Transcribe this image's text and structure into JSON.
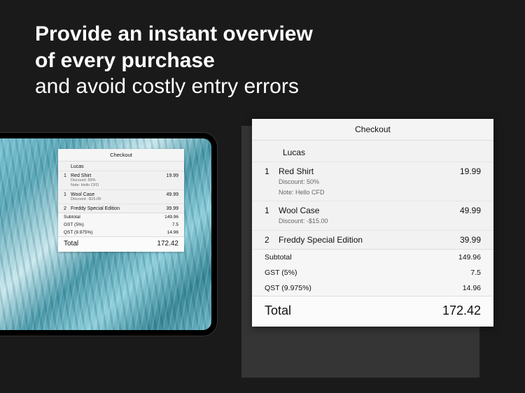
{
  "hero": {
    "line1": "Provide an instant overview",
    "line2": "of every purchase",
    "line3": "and avoid costly entry errors"
  },
  "receipt": {
    "title": "Checkout",
    "customer": "Lucas",
    "items": [
      {
        "qty": "1",
        "name": "Red Shirt",
        "price": "19.99",
        "discount": "Discount: 50%",
        "note": "Note: Hello CFD"
      },
      {
        "qty": "1",
        "name": "Wool Case",
        "price": "49.99",
        "discount": "Discount: -$15.00",
        "note": ""
      },
      {
        "qty": "2",
        "name": "Freddy Special Edition",
        "price": "39.99",
        "discount": "",
        "note": ""
      }
    ],
    "summary": [
      {
        "label": "Subtotal",
        "value": "149.96"
      },
      {
        "label": "GST (5%)",
        "value": "7.5"
      },
      {
        "label": "QST (9.975%)",
        "value": "14.96"
      }
    ],
    "total_label": "Total",
    "total_value": "172.42"
  },
  "small_receipt": {
    "summary": [
      {
        "label": "Subtotal",
        "value": "149.96"
      },
      {
        "label": "GST (5%)",
        "value": "7.5"
      },
      {
        "label": "QST (9.975%)",
        "value": "14.96"
      }
    ],
    "items": [
      {
        "qty": "1",
        "name": "Red Shirt",
        "price": "19.99",
        "discount": "Discount: 50%",
        "note": "Note: Hello CFD"
      },
      {
        "qty": "1",
        "name": "Wool Case",
        "price": "49.99",
        "discount": "Discount: -$15.09",
        "note": ""
      },
      {
        "qty": "2",
        "name": "Freddy Special Edition",
        "price": "39.99",
        "discount": "",
        "note": ""
      }
    ]
  }
}
